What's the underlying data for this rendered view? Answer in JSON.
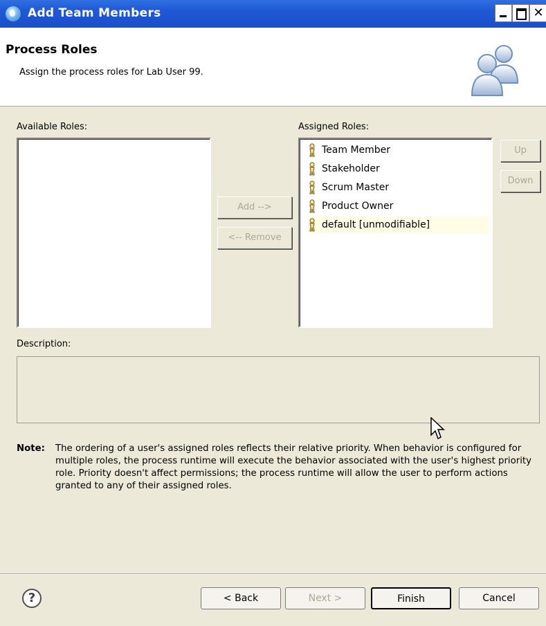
{
  "window": {
    "title": "Add Team Members"
  },
  "header": {
    "title": "Process Roles",
    "description": "Assign the process roles for Lab User 99."
  },
  "available_roles": {
    "label": "Available Roles:",
    "items": []
  },
  "assigned_roles": {
    "label": "Assigned Roles:",
    "items": [
      {
        "label": "Team Member"
      },
      {
        "label": "Stakeholder"
      },
      {
        "label": "Scrum Master"
      },
      {
        "label": "Product Owner"
      },
      {
        "label": "default [unmodifiable]"
      }
    ]
  },
  "buttons": {
    "add": "Add -->",
    "remove": "<-- Remove",
    "up": "Up",
    "down": "Down",
    "back": "< Back",
    "next": "Next >",
    "finish": "Finish",
    "cancel": "Cancel"
  },
  "description": {
    "label": "Description:"
  },
  "note": {
    "label": "Note:",
    "text": "The ordering of a user's assigned roles reflects their relative priority. When behavior is configured for multiple roles, the process runtime will execute the behavior associated with the user's highest priority role. Priority doesn't affect permissions; the process runtime will allow the user to perform actions granted to any of their assigned roles."
  },
  "icons": {
    "title": "team-members-icon",
    "header": "people-icon",
    "role": "person-role-icon",
    "help": "help-icon"
  },
  "colors": {
    "titlebar": "#1f58d6",
    "dialog": "#ece9d8",
    "selected_row": "#fffde6"
  }
}
